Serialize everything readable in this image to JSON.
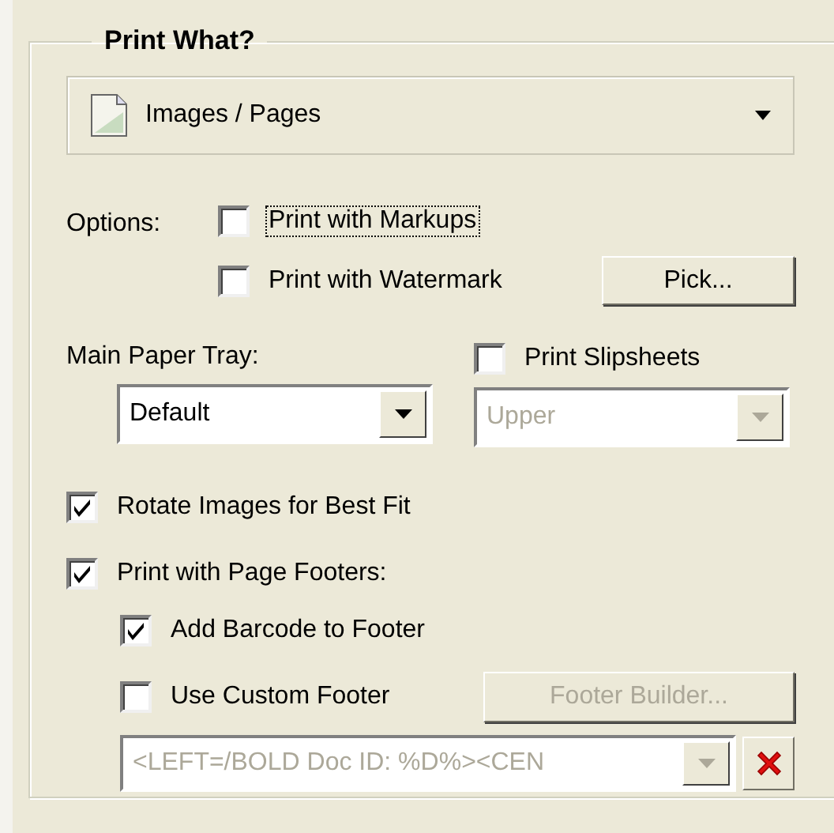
{
  "group": {
    "title": "Print What?"
  },
  "print_what": {
    "value": "Images / Pages"
  },
  "options": {
    "label": "Options:",
    "items": [
      {
        "label": "Print with Markups",
        "checked": false,
        "focused": true
      },
      {
        "label": "Print with Watermark",
        "checked": false,
        "focused": false
      }
    ],
    "pick_button": {
      "label": "Pick...",
      "disabled": false
    }
  },
  "paper_tray": {
    "label": "Main Paper Tray:",
    "value": "Default",
    "disabled": false
  },
  "slipsheets": {
    "label": "Print Slipsheets",
    "checked": false
  },
  "slipsheet_tray": {
    "value": "Upper",
    "disabled": true
  },
  "rotate": {
    "label": "Rotate Images for Best Fit",
    "checked": true
  },
  "footers": {
    "label": "Print with Page Footers:",
    "checked": true
  },
  "barcode": {
    "label": "Add Barcode to Footer",
    "checked": true
  },
  "custom_footer": {
    "label": "Use Custom Footer",
    "checked": false
  },
  "footer_builder": {
    "label": "Footer Builder...",
    "disabled": true
  },
  "footer_text": {
    "value": "<LEFT=/BOLD Doc ID: %D%><CEN",
    "disabled": true
  }
}
